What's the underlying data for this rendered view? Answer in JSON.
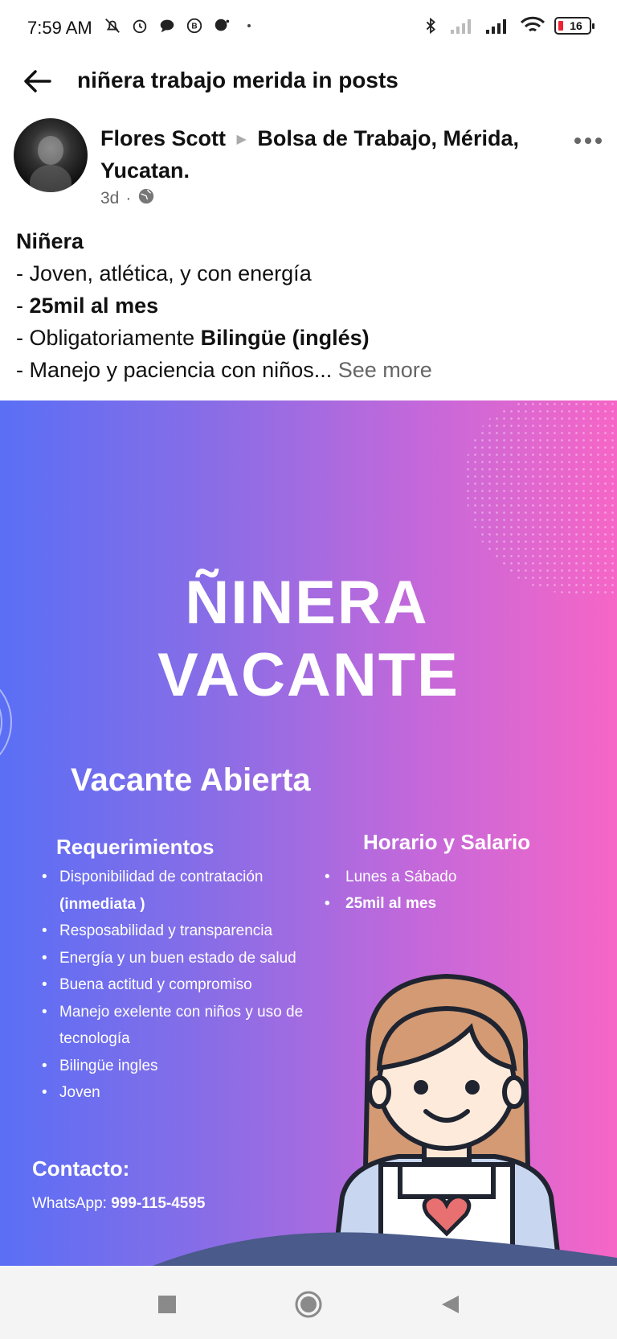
{
  "status": {
    "time": "7:59 AM",
    "battery": "16"
  },
  "header": {
    "title": "niñera trabajo merida in posts"
  },
  "post": {
    "author": "Flores Scott",
    "group": "Bolsa de Trabajo, Mérida, Yucatan.",
    "age": "3d",
    "text": {
      "line1": "Niñera",
      "line2": "- Joven, atlética, y con energía",
      "line3_prefix": "- ",
      "line3_bold": "25mil al mes",
      "line4_prefix": "- Obligatoriamente ",
      "line4_bold": "Bilingüe (inglés)",
      "line5": "- Manejo y paciencia con niños...",
      "see_more": " See more"
    }
  },
  "flyer": {
    "title_line1": "ÑINERA",
    "title_line2": "VACANTE",
    "subtitle": "Vacante Abierta",
    "requirements_heading": "Requerimientos",
    "requirements": [
      "Disponibilidad de contratación",
      "(inmediata )",
      "Resposabilidad y transparencia",
      "Energía y un buen estado de salud",
      "Buena actitud y compromiso",
      "Manejo exelente con niños y uso de tecnología",
      "Bilingüe ingles",
      "Joven"
    ],
    "schedule_heading": "Horario y Salario",
    "schedule": [
      "Lunes a Sábado",
      "25mil al mes"
    ],
    "contact_heading": "Contacto:",
    "contact_label": "WhatsApp: ",
    "contact_number": "999-115-4595",
    "colors": {
      "gradient_left": "#5a6ff5",
      "gradient_right": "#f666c6"
    }
  },
  "icons": {
    "back": "arrow-left-icon",
    "more": "more-horizontal-icon",
    "globe": "globe-icon",
    "nav_recents": "square-icon",
    "nav_home": "circle-icon",
    "nav_back": "triangle-back-icon"
  }
}
